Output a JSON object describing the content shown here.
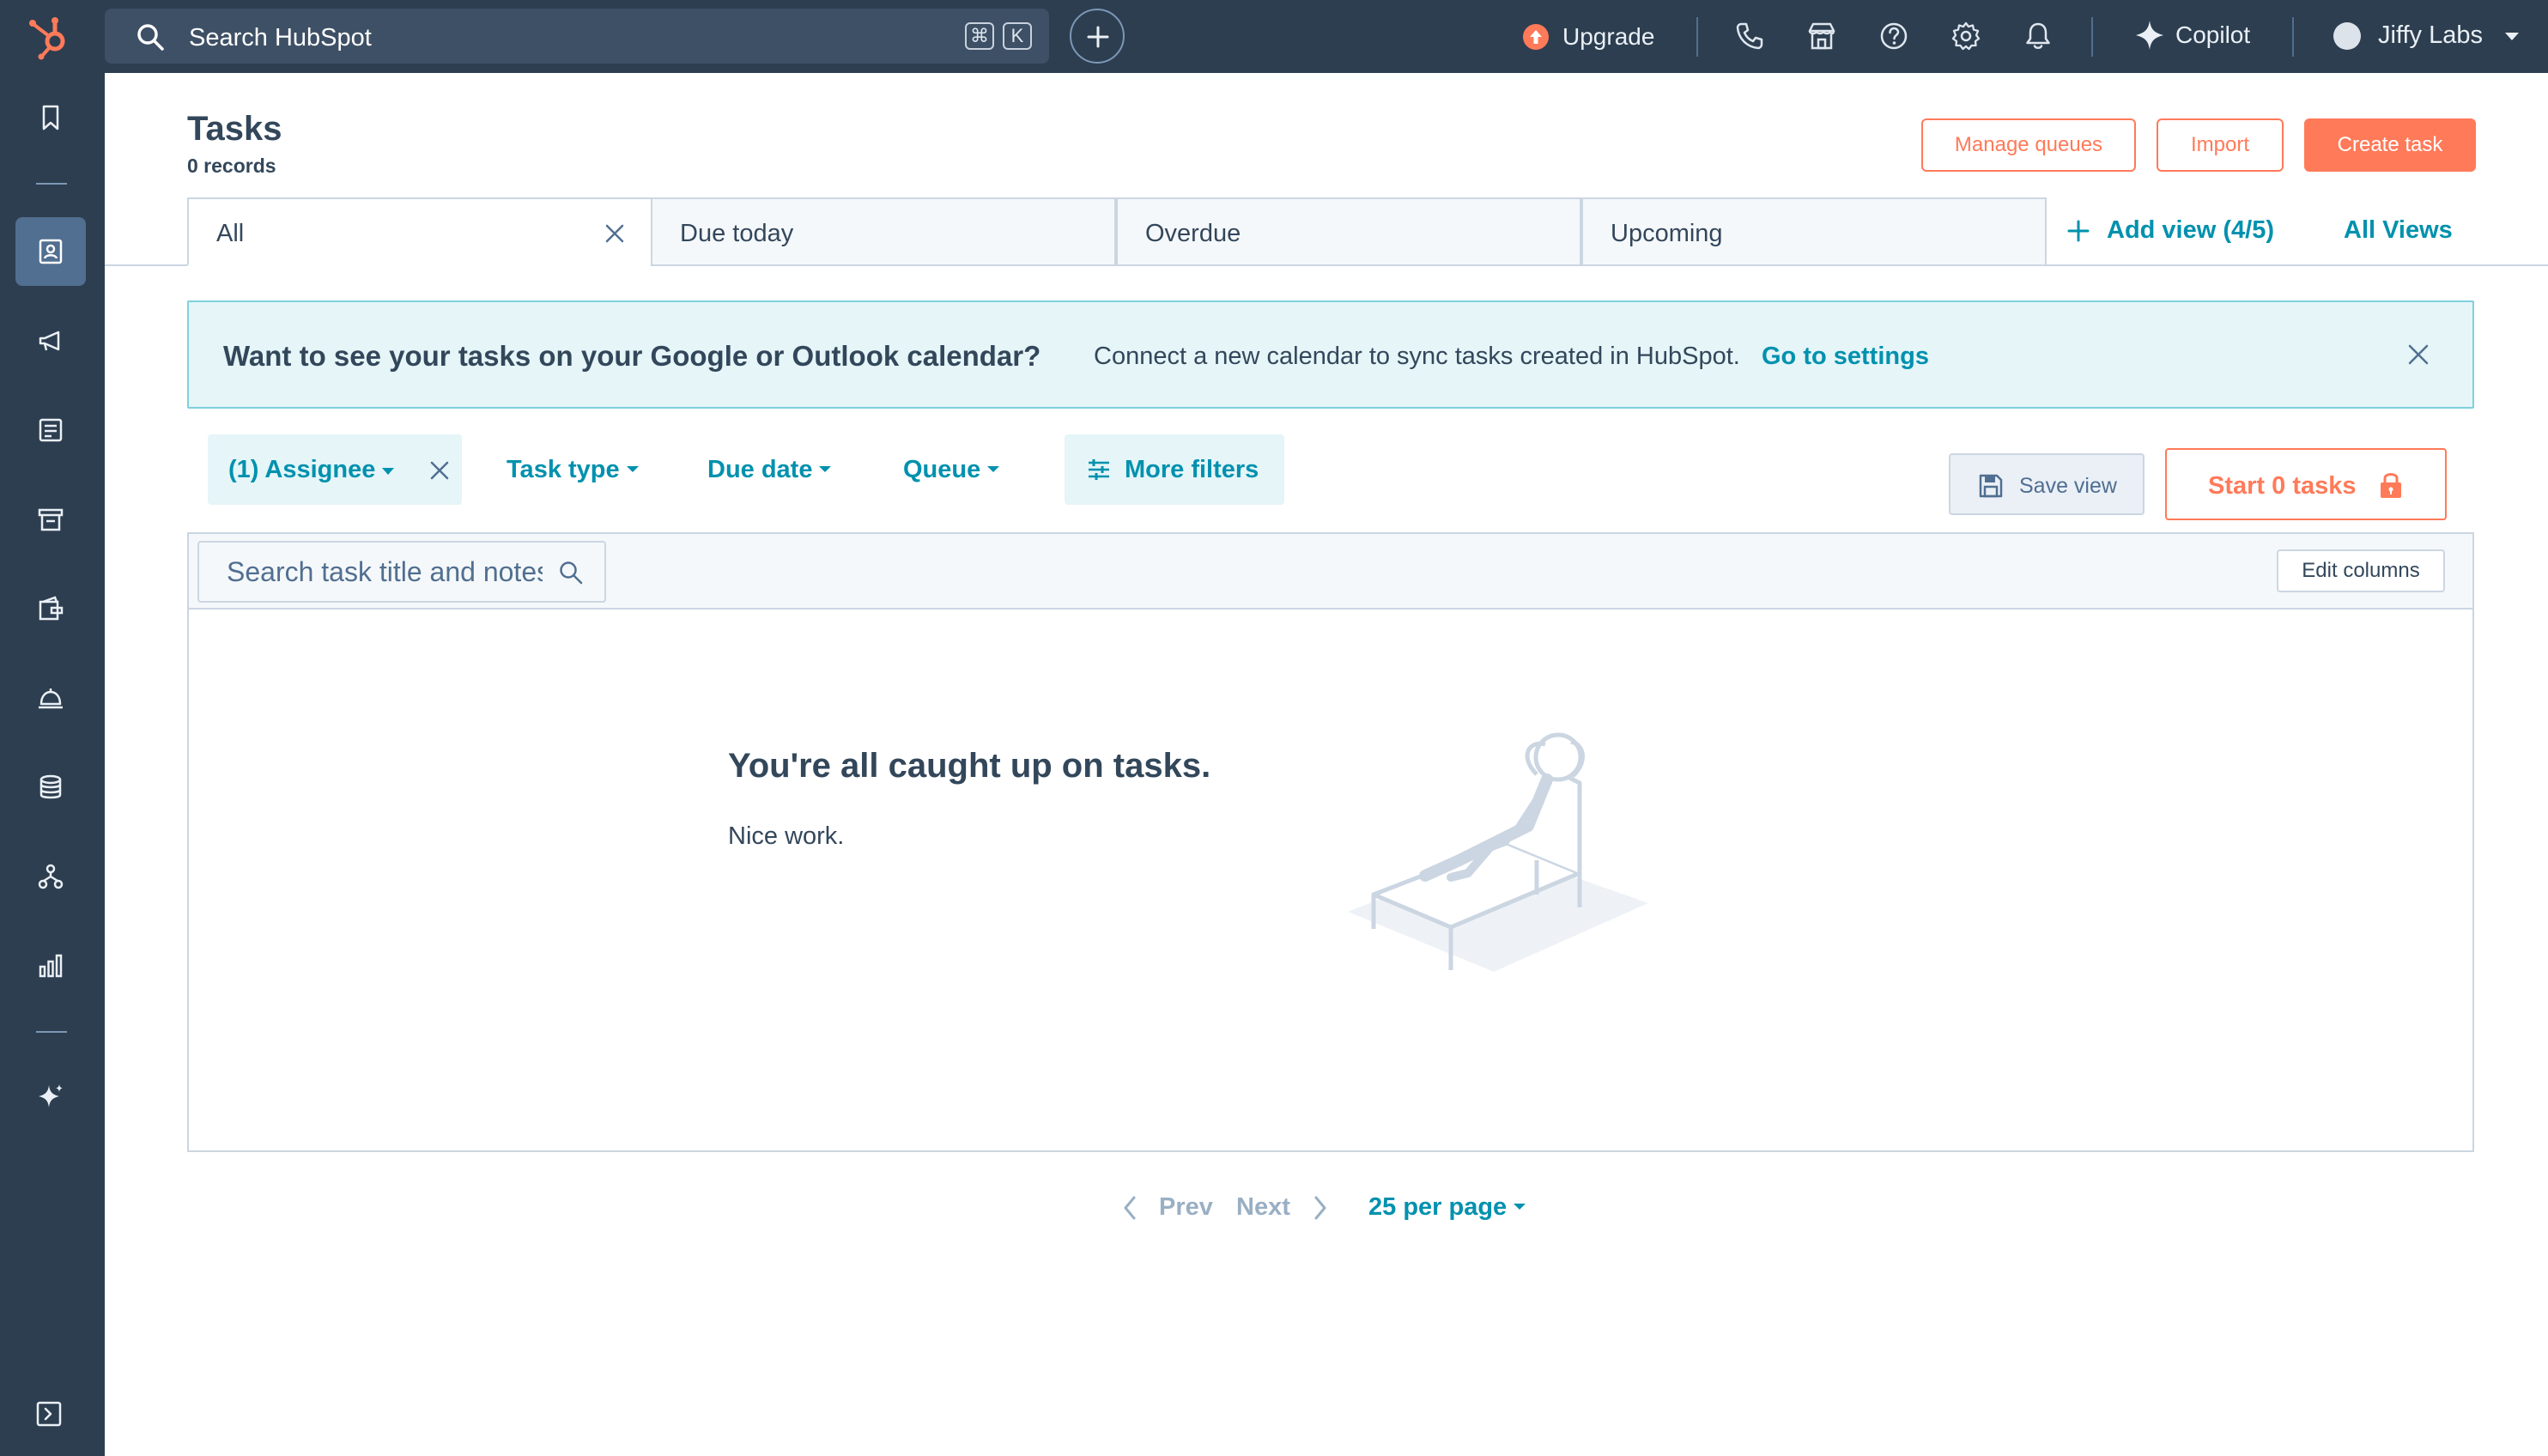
{
  "topbar": {
    "search_placeholder": "Search HubSpot",
    "shortcut_keys": [
      "⌘",
      "K"
    ],
    "upgrade_label": "Upgrade",
    "copilot_label": "Copilot",
    "account_name": "Jiffy Labs",
    "icons": [
      "phone-icon",
      "marketplace-icon",
      "help-icon",
      "settings-icon",
      "notifications-icon"
    ]
  },
  "sidenav": {
    "items": [
      "bookmarks-icon",
      "crm-icon",
      "marketing-icon",
      "content-icon",
      "commerce-icon",
      "sales-icon",
      "service-icon",
      "data-management-icon",
      "automation-icon",
      "reporting-icon",
      "breeze-ai-icon"
    ],
    "active": "crm-icon"
  },
  "page": {
    "title": "Tasks",
    "record_count": "0 records",
    "buttons": {
      "manage_queues": "Manage queues",
      "import": "Import",
      "create_task": "Create task"
    }
  },
  "views": {
    "tabs": [
      "All",
      "Due today",
      "Overdue",
      "Upcoming"
    ],
    "active": "All",
    "add_view": "Add view (4/5)",
    "all_views": "All Views"
  },
  "banner": {
    "title": "Want to see your tasks on your Google or Outlook calendar?",
    "text": "Connect a new calendar to sync tasks created in HubSpot.",
    "link": "Go to settings"
  },
  "filters": {
    "assignee": "(1) Assignee",
    "task_type": "Task type",
    "due_date": "Due date",
    "queue": "Queue",
    "more_filters": "More filters",
    "save_view": "Save view",
    "start_tasks": "Start 0 tasks"
  },
  "table": {
    "search_placeholder": "Search task title and notes",
    "edit_columns": "Edit columns",
    "empty_title": "You're all caught up on tasks.",
    "empty_subtitle": "Nice work."
  },
  "pagination": {
    "prev": "Prev",
    "next": "Next",
    "per_page": "25 per page"
  },
  "colors": {
    "nav_bg": "#2d3e50",
    "accent_orange": "#ff7a59",
    "link_teal": "#0091ae",
    "banner_bg": "#e5f5f8",
    "text": "#33475b"
  }
}
